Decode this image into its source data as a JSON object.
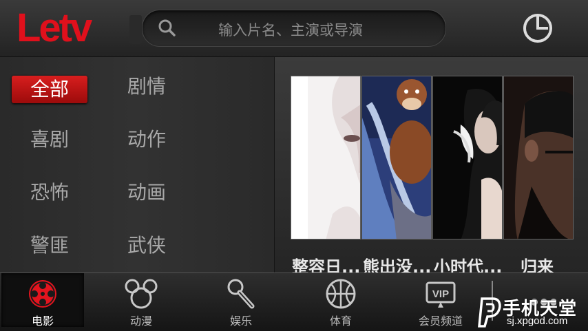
{
  "header": {
    "logo_text": "Letv",
    "search_placeholder": "输入片名、主演或导演",
    "history_icon": "clock-icon"
  },
  "categories": [
    {
      "label": "全部",
      "active": true
    },
    {
      "label": "剧情",
      "active": false
    },
    {
      "label": "喜剧",
      "active": false
    },
    {
      "label": "动作",
      "active": false
    },
    {
      "label": "恐怖",
      "active": false
    },
    {
      "label": "动画",
      "active": false
    },
    {
      "label": "警匪",
      "active": false
    },
    {
      "label": "武侠",
      "active": false
    }
  ],
  "posters": [
    {
      "title": "整容日..."
    },
    {
      "title": "熊出没..."
    },
    {
      "title": "小时代..."
    },
    {
      "title": "归来"
    }
  ],
  "tabs": [
    {
      "label": "电影",
      "icon": "film-reel-icon",
      "active": true
    },
    {
      "label": "动漫",
      "icon": "mouse-ears-icon",
      "active": false
    },
    {
      "label": "娱乐",
      "icon": "microphone-icon",
      "active": false
    },
    {
      "label": "体育",
      "icon": "basketball-icon",
      "active": false
    },
    {
      "label": "会员频道",
      "icon": "vip-icon",
      "active": false
    },
    {
      "label": "",
      "icon": "more-icon",
      "active": false
    }
  ],
  "watermark": {
    "title": "手机天堂",
    "url": "sj.xpgod.com"
  },
  "colors": {
    "brand_red": "#e0101c",
    "active_tab_bg": "#0f0f0f",
    "text_gray": "#a8a8a8"
  }
}
